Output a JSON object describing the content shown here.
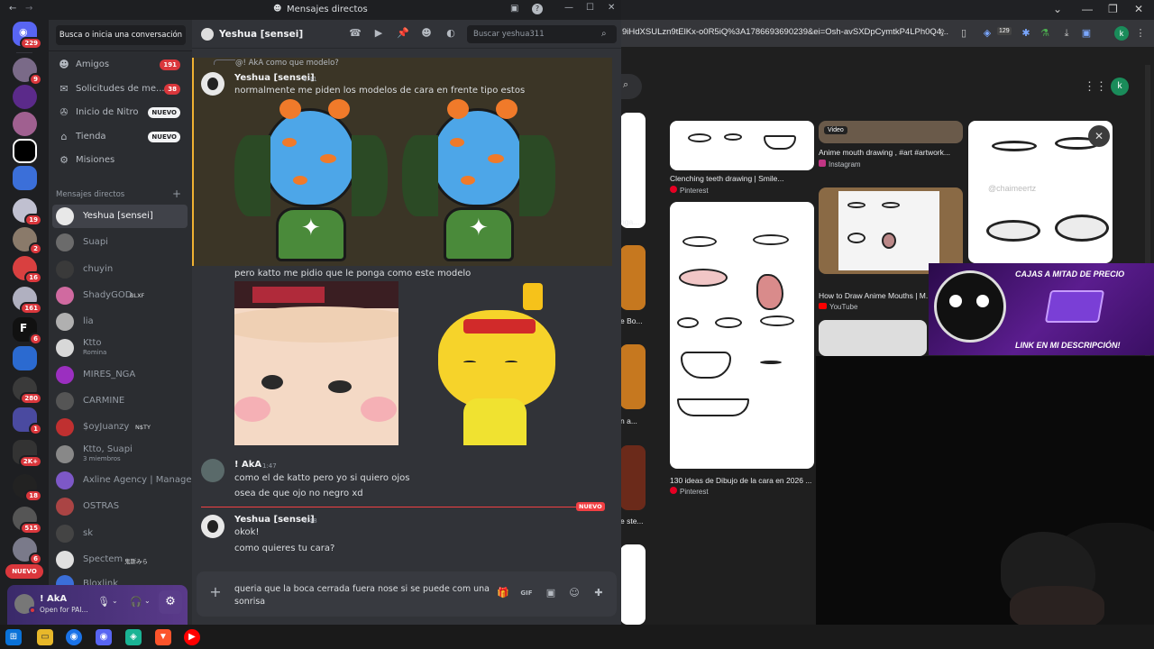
{
  "discord": {
    "window_title": "Mensajes directos",
    "guild_badges": [
      "229",
      "9",
      "19",
      "2",
      "16",
      "161",
      "6",
      "280",
      "1",
      "2K+",
      "18",
      "515",
      "6"
    ],
    "new_label": "NUEVO",
    "search_placeholder": "Busca o inicia una conversación",
    "nav": [
      {
        "label": "Amigos",
        "icon": "friends-icon",
        "badge": "191"
      },
      {
        "label": "Solicitudes de me...",
        "icon": "mail-icon",
        "badge": "38"
      },
      {
        "label": "Inicio de Nitro",
        "icon": "nitro-icon",
        "badge": "NUEVO"
      },
      {
        "label": "Tienda",
        "icon": "shop-icon",
        "badge": "NUEVO"
      },
      {
        "label": "Misiones",
        "icon": "quests-icon",
        "badge": ""
      }
    ],
    "dm_header": "Mensajes directos",
    "dms": [
      {
        "name": "Yeshua [sensei]",
        "sub": "",
        "tag": "",
        "color": "#e8e8e8"
      },
      {
        "name": "Suapi",
        "sub": "",
        "tag": "",
        "color": "#6b6b6b"
      },
      {
        "name": "chuyin",
        "sub": "",
        "tag": "",
        "color": "#3a3a3a"
      },
      {
        "name": "ShadyGOD",
        "sub": "",
        "tag": "BLXF",
        "color": "#d06aa0"
      },
      {
        "name": "lia",
        "sub": "",
        "tag": "",
        "color": "#b0b0b0"
      },
      {
        "name": "Ktto",
        "sub": "Romina",
        "tag": "",
        "color": "#d8d8d8"
      },
      {
        "name": "MIRES_NGA",
        "sub": "",
        "tag": "",
        "color": "#9b2fc0"
      },
      {
        "name": "CARMINE",
        "sub": "",
        "tag": "",
        "color": "#555"
      },
      {
        "name": "$oyJuanzy",
        "sub": "",
        "tag": "N$TY",
        "color": "#c03030"
      },
      {
        "name": "Ktto, Suapi",
        "sub": "3 miembros",
        "tag": "",
        "color": "#888"
      },
      {
        "name": "Axline Agency | Manage...",
        "sub": "",
        "tag": "",
        "color": "#7d58c7"
      },
      {
        "name": "OSTRAS",
        "sub": "",
        "tag": "",
        "color": "#aa4444"
      },
      {
        "name": "sk",
        "sub": "",
        "tag": "",
        "color": "#444"
      },
      {
        "name": "Spectem",
        "sub": "",
        "tag": "鬼斯みら",
        "color": "#e0e0e0"
      },
      {
        "name": "Bloxlink",
        "sub": "",
        "tag": "",
        "color": "#3b6fd9"
      }
    ],
    "user": {
      "name": "! AkA",
      "status": "Open for PAI..."
    },
    "channel_name": "Yeshua [sensei]",
    "channel_search": "Buscar yeshua311",
    "reply_preview": "@! AkA como que  modelo?",
    "messages": [
      {
        "author": "Yeshua [sensei]",
        "time": "1:41",
        "lines": [
          "normalmente me piden los modelos de cara en frente tipo estos"
        ]
      },
      {
        "author": "",
        "time": "",
        "lines": [
          "pero katto me pidio que le ponga como este modelo"
        ]
      },
      {
        "author": "! AkA",
        "time": "1:47",
        "lines": [
          "como el de katto pero yo si  quiero ojos",
          "osea de que ojo no negro xd"
        ]
      },
      {
        "author": "Yeshua [sensei]",
        "time": "1:48",
        "lines": [
          "okok!",
          "como quieres tu cara?"
        ]
      }
    ],
    "new_divider": "NUEVO",
    "composer_lines": [
      "queria  que la  boca cerrada fuera nose si se puede com  una",
      "sonrisa"
    ]
  },
  "browser": {
    "url": "9iHdXSULzn9tElKx-o0R5iQ%3A1786693690239&ei=Osh-avSXDpCymtkP4LPh0Q4...",
    "ext_badge": "129",
    "profile_letter": "k",
    "results": [
      {
        "caption": "Clenching teeth drawing | Smile...",
        "source": "Pinterest"
      },
      {
        "caption": "Anime mouth drawing , #art #artwork...",
        "source": "Instagram",
        "badge": "Video"
      },
      {
        "caption": "How to Draw Anime Mouths | M...",
        "source": "YouTube"
      },
      {
        "caption": "130 ideas de Dibujo de la cara en 2026 ...",
        "source": "Pinterest"
      }
    ],
    "partial_captions": [
      "nga...",
      "e Bo...",
      "n a...",
      "e ste..."
    ],
    "watermark": "@chaimeertz"
  },
  "promo": {
    "line1": "CAJAS A MITAD DE PRECIO",
    "line2": "LINK EN MI DESCRIPCIÓN!"
  }
}
